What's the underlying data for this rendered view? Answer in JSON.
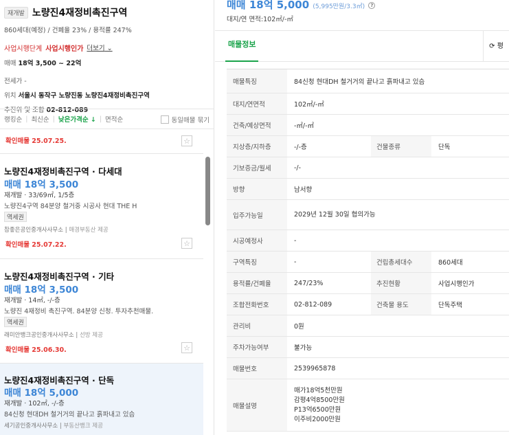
{
  "complex": {
    "type_badge": "재개발",
    "name": "노량진4재정비촉진구역",
    "sub": "860세대(예정) / 건폐율 23% / 용적률 247%",
    "stage_label": "사업시행단계",
    "stage_value": "사업시행인가",
    "more": "더보기",
    "sale_label": "매매",
    "sale_value": "18억 3,500 ~ 22억",
    "jeonse_label": "전세가",
    "jeonse_value": "-",
    "location_label": "위치",
    "location_value": "서울시 동작구 노량진동 노량진4재정비촉진구역",
    "union_label": "추진위 및 조합",
    "union_value": "02-812-089"
  },
  "sort": {
    "items": [
      "랭킹순",
      "최신순",
      "낮은가격순 ↓",
      "면적순"
    ],
    "group_label": "동일매물 묶기"
  },
  "listings": [
    {
      "confirm": "확인매물 25.07.25."
    },
    {
      "name": "노량진4재정비촉진구역 · 다세대",
      "price": "매매 18억 3,500",
      "spec": "재개발 · 33/69㎡, 1/5층",
      "desc": "노량진4구역 84분양 철거중 시공사 현대 THE H",
      "tag": "역세권",
      "agency": "참좋은공인중개사사무소",
      "source": "매경부동산 제공",
      "confirm": "확인매물 25.07.22."
    },
    {
      "name": "노량진4재정비촉진구역 · 기타",
      "price": "매매 18억 3,500",
      "spec": "재개발 · 14㎡, -/-층",
      "desc": "노량진 4재정비 촉진구역. 84분양 신청. 투자추천매물.",
      "tag": "역세권",
      "agency": "래미안뱅크공인중개사사무소",
      "source": "선방 제공",
      "confirm": "확인매물 25.06.30."
    },
    {
      "name": "노량진4재정비촉진구역 · 단독",
      "price": "매매 18억 5,000",
      "spec": "재개발 · 102㎡, -/-층",
      "desc": "84신청 현대DH 철거거의 끝나고 흙파내고 있슴",
      "agency": "세기공인중개사사무소",
      "source": "부동산뱅크 제공"
    }
  ],
  "detail": {
    "price": "매매 18억 5,000",
    "price_per_area": "(5,995만원/3.3㎡)",
    "area_line": "대지/연 면적:102㎡/-㎡",
    "tab": "매물정보",
    "refresh": "평",
    "rows": [
      {
        "label": "매물특징",
        "value": "84신청 현대DH 철거거의 끝나고 흙파내고 있슴"
      },
      {
        "label": "대지/연면적",
        "value": "102㎡/-㎡"
      },
      {
        "label": "건축/예상면적",
        "value": "-㎡/-㎡"
      },
      {
        "label": "지상층/지하층",
        "value": "-/-층",
        "label2": "건물종류",
        "value2": "단독"
      },
      {
        "label": "기보증금/월세",
        "value": "-/-"
      },
      {
        "label": "방향",
        "value": "남서향"
      },
      {
        "label": "입주가능일",
        "value": "2029년 12월 30일 협의가능"
      },
      {
        "label": "시공예정사",
        "value": "-"
      },
      {
        "label": "구역특징",
        "value": "-",
        "label2": "건립총세대수",
        "value2": "860세대"
      },
      {
        "label": "용적률/건폐율",
        "value": "247/23%",
        "label2": "추진현황",
        "value2": "사업시행인가"
      },
      {
        "label": "조합전화번호",
        "value": "02-812-089",
        "label2": "건축물 용도",
        "value2": "단독주택"
      },
      {
        "label": "관리비",
        "value": "0원"
      },
      {
        "label": "주차가능여부",
        "value": "불가능"
      },
      {
        "label": "매물번호",
        "value": "2539965878"
      },
      {
        "label": "매물설명",
        "value": "매가18억5천만원\n감평4억8500만원\nP13억6500만원\n이주비2000만원"
      }
    ]
  }
}
